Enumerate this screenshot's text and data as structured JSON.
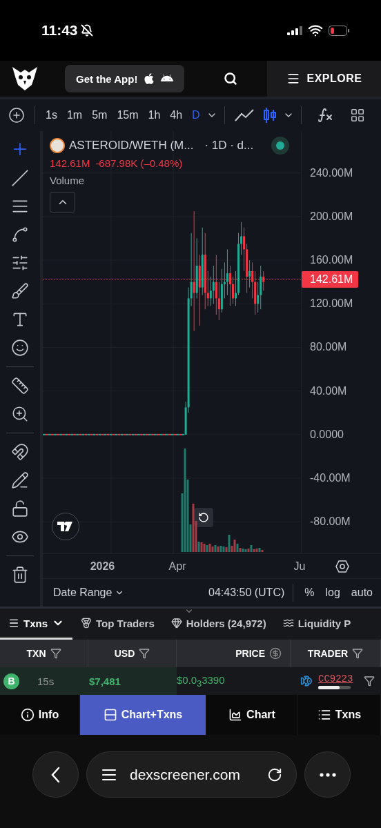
{
  "status_bar": {
    "time": "11:43"
  },
  "header": {
    "app_button": "Get the App!",
    "explore": "EXPLORE"
  },
  "toolbar": {
    "intervals": [
      {
        "label": "1s",
        "selected": false
      },
      {
        "label": "1m",
        "selected": false
      },
      {
        "label": "5m",
        "selected": false
      },
      {
        "label": "15m",
        "selected": false
      },
      {
        "label": "1h",
        "selected": false
      },
      {
        "label": "4h",
        "selected": false
      },
      {
        "label": "D",
        "selected": true
      }
    ],
    "chart_types": [
      {
        "kind": "line",
        "selected": false
      },
      {
        "kind": "candles",
        "selected": true
      }
    ]
  },
  "legend": {
    "symbol": "ASTEROID/WETH (M...",
    "meta": "· 1D · d...",
    "price": "142.61M",
    "change": "-687.98K (–0.48%)",
    "indicator": "Volume"
  },
  "price_axis": {
    "last_price": "142.61M",
    "chart_data": {
      "type": "candlestick",
      "ylim": [
        -109,
        278.5
      ],
      "yticks": [
        {
          "value": 240,
          "label": "240.00M"
        },
        {
          "value": 200,
          "label": "200.00M"
        },
        {
          "value": 160,
          "label": "160.00M"
        },
        {
          "value": 120,
          "label": "120.00M"
        },
        {
          "value": 80,
          "label": "80.00M"
        },
        {
          "value": 40,
          "label": "40.00M"
        },
        {
          "value": 0,
          "label": "0.0000"
        },
        {
          "value": -40,
          "label": "-40.00M"
        },
        {
          "value": -80,
          "label": "-80.00M"
        }
      ],
      "categories": [
        null,
        null,
        null,
        null,
        null,
        null,
        null,
        null,
        null,
        null,
        null,
        null,
        null,
        null,
        null,
        null,
        null,
        null,
        null,
        null,
        null,
        "2026",
        null,
        null,
        null,
        null,
        null,
        null,
        null,
        null,
        null,
        null,
        null,
        null,
        null,
        null,
        null,
        null,
        null,
        null,
        null,
        null,
        null,
        null,
        null,
        null,
        null,
        null,
        "Apr",
        null,
        null,
        null,
        null,
        null,
        null,
        null,
        null,
        null,
        null,
        null,
        null,
        null,
        null,
        null,
        null,
        null,
        null,
        null,
        null,
        null,
        null,
        null,
        null,
        null,
        null,
        null,
        null,
        null,
        null,
        null,
        null,
        null,
        null,
        null,
        null,
        null,
        null,
        null,
        null,
        null,
        null,
        null,
        "Ju"
      ],
      "grid": true,
      "ref_lines": [
        {
          "axis": "y",
          "value": 142.61,
          "color": "#f23645"
        }
      ],
      "ohlc": [
        [
          0,
          0,
          0,
          0
        ],
        [
          0,
          0,
          0,
          0
        ],
        [
          0,
          0,
          0,
          0
        ],
        [
          0,
          0,
          0,
          0
        ],
        [
          0,
          0,
          0,
          0
        ],
        [
          0,
          0,
          0,
          0
        ],
        [
          0,
          0,
          0,
          0
        ],
        [
          0,
          0,
          0,
          0
        ],
        [
          0,
          0,
          0,
          0
        ],
        [
          0,
          0,
          0,
          0
        ],
        [
          0,
          0,
          0,
          0
        ],
        [
          0,
          0,
          0,
          0
        ],
        [
          0,
          0,
          0,
          0
        ],
        [
          0,
          0,
          0,
          0
        ],
        [
          0,
          0,
          0,
          0
        ],
        [
          0,
          0,
          0,
          0
        ],
        [
          0,
          0,
          0,
          0
        ],
        [
          0,
          0,
          0,
          0
        ],
        [
          0,
          0,
          0,
          0
        ],
        [
          0,
          0,
          0,
          0
        ],
        [
          0,
          0,
          0,
          0
        ],
        [
          0,
          0,
          0,
          0
        ],
        [
          0,
          0,
          0,
          0
        ],
        [
          0,
          0,
          0,
          0
        ],
        [
          0,
          0,
          0,
          0
        ],
        [
          0,
          0,
          0,
          0
        ],
        [
          0,
          0,
          0,
          0
        ],
        [
          0,
          0,
          0,
          0
        ],
        [
          0,
          0,
          0,
          0
        ],
        [
          0,
          0,
          0,
          0
        ],
        [
          0,
          0,
          0,
          0
        ],
        [
          0,
          0,
          0,
          0
        ],
        [
          0,
          0,
          0,
          0
        ],
        [
          0,
          0,
          0,
          0
        ],
        [
          0,
          0,
          0,
          0
        ],
        [
          0,
          0,
          0,
          0
        ],
        [
          0,
          0,
          0,
          0
        ],
        [
          0,
          0,
          0,
          0
        ],
        [
          0,
          0,
          0,
          0
        ],
        [
          0,
          0,
          0,
          0
        ],
        [
          0,
          0,
          0,
          0
        ],
        [
          0,
          0,
          0,
          0
        ],
        [
          0,
          0,
          0,
          0
        ],
        [
          0,
          0,
          0,
          0
        ],
        [
          0,
          0,
          0,
          0
        ],
        [
          0,
          0,
          0,
          0
        ],
        [
          0,
          0,
          0,
          0
        ],
        [
          0,
          0,
          0,
          0
        ],
        [
          0,
          0,
          0,
          0
        ],
        [
          0,
          0,
          0,
          0
        ],
        [
          0,
          0,
          0,
          0
        ],
        [
          0,
          30,
          0,
          25
        ],
        [
          25,
          135,
          20,
          125
        ],
        [
          125,
          185,
          118,
          140
        ],
        [
          140,
          205,
          95,
          130
        ],
        [
          130,
          180,
          125,
          155
        ],
        [
          155,
          165,
          100,
          135
        ],
        [
          135,
          190,
          128,
          165
        ],
        [
          165,
          185,
          115,
          130
        ],
        [
          130,
          150,
          118,
          125
        ],
        [
          125,
          145,
          118,
          132
        ],
        [
          132,
          155,
          120,
          140
        ],
        [
          140,
          165,
          110,
          125
        ],
        [
          125,
          140,
          105,
          115
        ],
        [
          115,
          152,
          112,
          138
        ],
        [
          138,
          158,
          125,
          140
        ],
        [
          140,
          170,
          128,
          148
        ],
        [
          148,
          155,
          118,
          138
        ],
        [
          138,
          145,
          120,
          125
        ],
        [
          125,
          150,
          118,
          130
        ],
        [
          130,
          185,
          128,
          175
        ],
        [
          175,
          195,
          165,
          182
        ],
        [
          182,
          190,
          150,
          170
        ],
        [
          170,
          175,
          130,
          145
        ],
        [
          145,
          160,
          135,
          150
        ],
        [
          150,
          158,
          125,
          140
        ],
        [
          140,
          150,
          110,
          120
        ],
        [
          120,
          140,
          112,
          128
        ],
        [
          128,
          155,
          115,
          145
        ],
        [
          145,
          150,
          132,
          140
        ],
        null,
        null,
        null,
        null,
        null,
        null,
        null,
        null,
        null,
        null,
        null,
        null,
        null
      ]
    }
  },
  "chart_footer": {
    "date_range": "Date Range",
    "clock": "04:43:50 (UTC)",
    "options": [
      "%",
      "log",
      "auto"
    ]
  },
  "panel_tabs": [
    {
      "label": "Txns",
      "selected": true
    },
    {
      "label": "Top Traders",
      "selected": false
    },
    {
      "label": "Holders (24,972)",
      "selected": false
    },
    {
      "label": "Liquidity P",
      "selected": false
    }
  ],
  "table": {
    "columns": [
      "TXN",
      "USD",
      "PRICE",
      "TRADER"
    ],
    "rows": [
      {
        "side": "B",
        "age": "15s",
        "usd": "$7,481",
        "price": "$0.0$_{3}$3390",
        "trader": "CC9223",
        "level": 0.65
      }
    ]
  },
  "view_tabs": [
    {
      "label": "Info",
      "selected": false
    },
    {
      "label": "Chart+Txns",
      "selected": true
    },
    {
      "label": "Chart",
      "selected": false
    },
    {
      "label": "Txns",
      "selected": false
    }
  ],
  "browser": {
    "url": "dexscreener.com"
  }
}
